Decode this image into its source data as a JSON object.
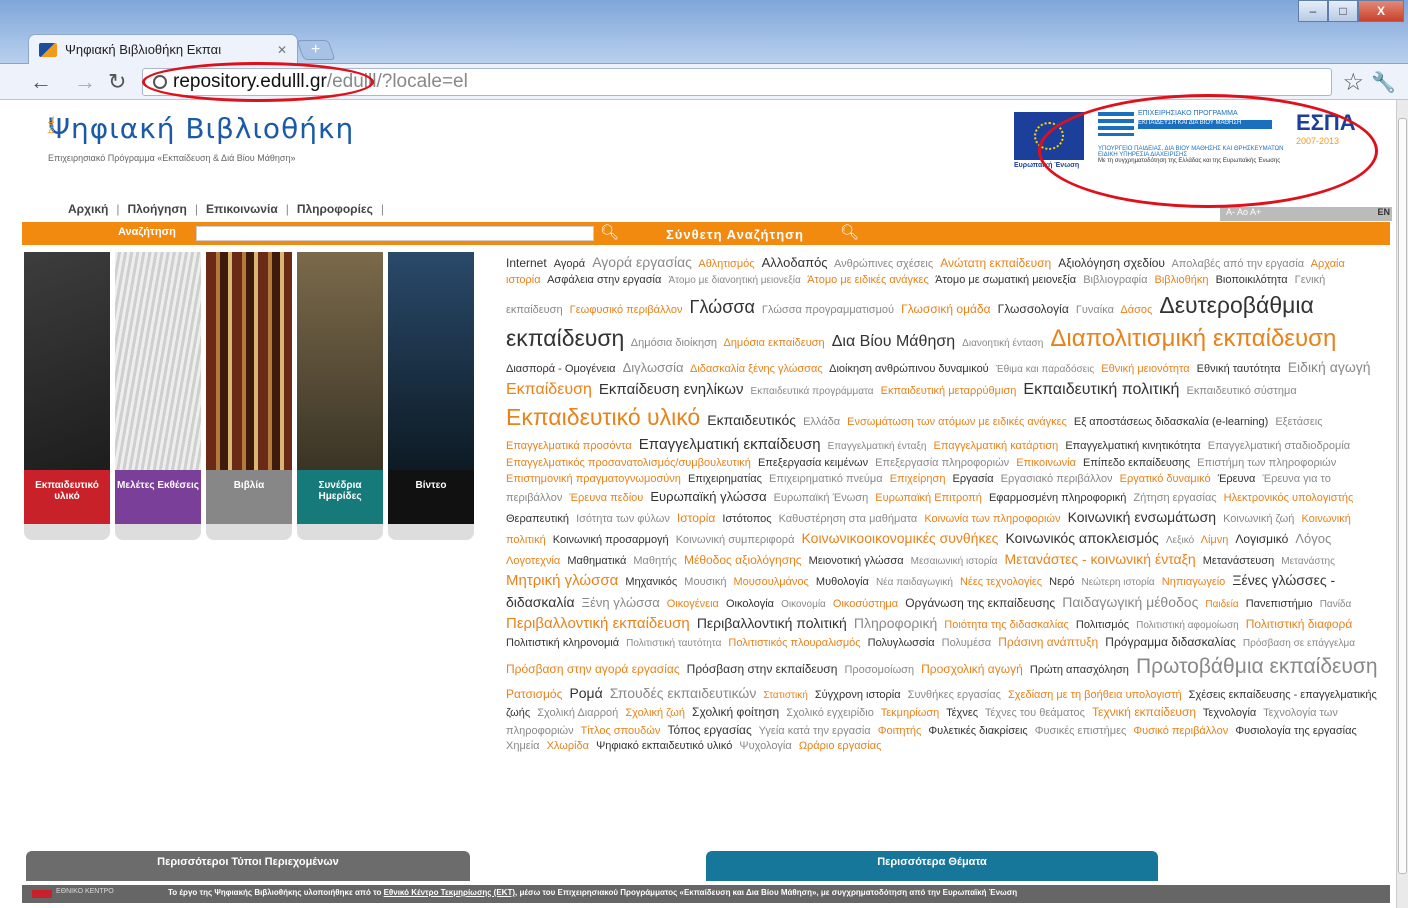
{
  "browser": {
    "tab_title": "Ψηφιακή Βιβλιοθήκη Εκπαι",
    "new_tab": "+",
    "url_host": "repository.edulll.gr",
    "url_path": "/edulll/?locale=el",
    "window_min": "‒",
    "window_max": "□",
    "window_close": "X"
  },
  "site": {
    "title": "Ψηφιακή Βιβλιοθήκη",
    "beta": "beta",
    "subtitle": "Επιχειρησιακό Πρόγραμμα «Εκπαίδευση & Διά Βίου Μάθηση»",
    "eu_caption": "Ευρωπαϊκή Ένωση",
    "program_line1": "ΕΠΙΧΕΙΡΗΣΙΑΚΟ ΠΡΟΓΡΑΜΜΑ",
    "program_line2": "ΕΚΠΑΙΔΕΥΣΗ ΚΑΙ ΔΙΑ ΒΙΟΥ ΜΑΘΗΣΗ",
    "program_line3": "ΥΠΟΥΡΓΕΙΟ ΠΑΙΔΕΙΑΣ, ΔΙΑ ΒΙΟΥ ΜΑΘΗΣΗΣ ΚΑΙ ΘΡΗΣΚΕΥΜΑΤΩΝ  ΕΙΔΙΚΗ ΥΠΗΡΕΣΙΑ ΔΙΑΧΕΙΡΙΣΗΣ",
    "program_line4": "Με τη συγχρηματοδότηση της Ελλάδας και της Ευρωπαϊκής Ένωσης",
    "espa": "ΕΣΠΑ",
    "espa_years": "2007-2013"
  },
  "nav": {
    "home": "Αρχική",
    "navigation": "Πλοήγηση",
    "contact": "Επικοινωνία",
    "info": "Πληροφορίες",
    "sep": "|",
    "font_sizes": "A- Ao A+",
    "lang": "EN"
  },
  "search": {
    "label": "Αναζήτηση",
    "advanced": "Σύνθετη Αναζήτηση"
  },
  "tiles": [
    {
      "label": "Εκπαιδευτικό υλικό"
    },
    {
      "label": "Μελέτες Εκθέσεις"
    },
    {
      "label": "Βιβλία"
    },
    {
      "label": "Συνέδρια Ημερίδες"
    },
    {
      "label": "Βίντεο"
    }
  ],
  "tag_cloud": [
    [
      "Internet",
      "d",
      12
    ],
    [
      "Αγορά",
      "d",
      11
    ],
    [
      "Αγορά εργασίας",
      "g",
      14
    ],
    [
      "Αθλητισμός",
      "o",
      11
    ],
    [
      "Αλλοδαπός",
      "d",
      13
    ],
    [
      "Ανθρώπινες σχέσεις",
      "g",
      11
    ],
    [
      "Ανώτατη εκπαίδευση",
      "o",
      12
    ],
    [
      "Αξιολόγηση σχεδίου",
      "d",
      12
    ],
    [
      "Απολαβές από την εργασία",
      "g",
      11
    ],
    [
      "Αρχαία ιστορία",
      "o",
      11
    ],
    [
      "Ασφάλεια στην εργασία",
      "d",
      11
    ],
    [
      "Άτομο με διανοητική μειονεξία",
      "g",
      10
    ],
    [
      "Άτομο με ειδικές ανάγκες",
      "o",
      11
    ],
    [
      "Άτομο με σωματική μειονεξία",
      "d",
      11
    ],
    [
      "Βιβλιογραφία",
      "g",
      11
    ],
    [
      "Βιβλιοθήκη",
      "o",
      11
    ],
    [
      "Βιοποικιλότητα",
      "d",
      11
    ],
    [
      "Γενική εκπαίδευση",
      "g",
      11
    ],
    [
      "Γεωφυσικό περιβάλλον",
      "o",
      11
    ],
    [
      "Γλώσσα",
      "d",
      18
    ],
    [
      "Γλώσσα προγραμματισμού",
      "g",
      11
    ],
    [
      "Γλωσσική ομάδα",
      "o",
      12
    ],
    [
      "Γλωσσολογία",
      "d",
      12
    ],
    [
      "Γυναίκα",
      "g",
      11
    ],
    [
      "Δάσος",
      "o",
      11
    ],
    [
      "Δευτεροβάθμια εκπαίδευση",
      "d",
      23
    ],
    [
      "Δημόσια διοίκηση",
      "g",
      11
    ],
    [
      "Δημόσια εκπαίδευση",
      "o",
      11
    ],
    [
      "Δια Βίου Μάθηση",
      "d",
      16
    ],
    [
      "Διανοητική ένταση",
      "g",
      10
    ],
    [
      "Διαπολιτισμική εκπαίδευση",
      "o",
      24
    ],
    [
      "Διασπορά - Ομογένεια",
      "d",
      11
    ],
    [
      "Διγλωσσία",
      "g",
      13
    ],
    [
      "Διδασκαλία ξένης γλώσσας",
      "o",
      11
    ],
    [
      "Διοίκηση ανθρώπινου δυναμικού",
      "d",
      11
    ],
    [
      "Έθιμα και παραδόσεις",
      "g",
      10
    ],
    [
      "Εθνική μειονότητα",
      "o",
      11
    ],
    [
      "Εθνική ταυτότητα",
      "d",
      11
    ],
    [
      "Ειδική αγωγή",
      "g",
      14
    ],
    [
      "Εκπαίδευση",
      "o",
      16
    ],
    [
      "Εκπαίδευση ενηλίκων",
      "d",
      15
    ],
    [
      "Εκπαιδευτικά προγράμματα",
      "g",
      10
    ],
    [
      "Εκπαιδευτική μεταρρύθμιση",
      "o",
      11
    ],
    [
      "Εκπαιδευτική πολιτική",
      "d",
      16
    ],
    [
      "Εκπαιδευτικό σύστημα",
      "g",
      11
    ],
    [
      "Εκπαιδευτικό υλικό",
      "o",
      23
    ],
    [
      "Εκπαιδευτικός",
      "d",
      14
    ],
    [
      "Ελλάδα",
      "g",
      11
    ],
    [
      "Ενσωμάτωση των ατόμων με ειδικές ανάγκες",
      "o",
      11
    ],
    [
      "Εξ αποστάσεως διδασκαλία (e-learning)",
      "d",
      11
    ],
    [
      "Εξετάσεις",
      "g",
      11
    ],
    [
      "Επαγγελματικά προσόντα",
      "o",
      11
    ],
    [
      "Επαγγελματική εκπαίδευση",
      "d",
      15
    ],
    [
      "Επαγγελματική ένταξη",
      "g",
      10
    ],
    [
      "Επαγγελματική κατάρτιση",
      "o",
      11
    ],
    [
      "Επαγγελματική κινητικότητα",
      "d",
      11
    ],
    [
      "Επαγγελματική σταδιοδρομία",
      "g",
      11
    ],
    [
      "Επαγγελματικός προσανατολισμός/συμβουλευτική",
      "o",
      11
    ],
    [
      "Επεξεργασία κειμένων",
      "d",
      11
    ],
    [
      "Επεξεργασία πληροφοριών",
      "g",
      11
    ],
    [
      "Επικοινωνία",
      "o",
      11
    ],
    [
      "Επίπεδο εκπαίδευσης",
      "d",
      11
    ],
    [
      "Επιστήμη των πληροφοριών",
      "g",
      11
    ],
    [
      "Επιστημονική πραγματογνωμοσύνη",
      "o",
      11
    ],
    [
      "Επιχειρηματίας",
      "d",
      11
    ],
    [
      "Επιχειρηματικό πνεύμα",
      "g",
      11
    ],
    [
      "Επιχείρηση",
      "o",
      11
    ],
    [
      "Εργασία",
      "d",
      11
    ],
    [
      "Εργασιακό περιβάλλον",
      "g",
      11
    ],
    [
      "Εργατικό δυναμικό",
      "o",
      11
    ],
    [
      "Έρευνα",
      "d",
      11
    ],
    [
      "Έρευνα για το περιβάλλον",
      "g",
      11
    ],
    [
      "Έρευνα πεδίου",
      "o",
      11
    ],
    [
      "Ευρωπαϊκή γλώσσα",
      "d",
      13
    ],
    [
      "Ευρωπαϊκή Ένωση",
      "g",
      11
    ],
    [
      "Ευρωπαϊκή Επιτροπή",
      "o",
      11
    ],
    [
      "Εφαρμοσμένη πληροφορική",
      "d",
      11
    ],
    [
      "Ζήτηση εργασίας",
      "g",
      11
    ],
    [
      "Ηλεκτρονικός υπολογιστής",
      "o",
      11
    ],
    [
      "Θεραπευτική",
      "d",
      11
    ],
    [
      "Ισότητα των φύλων",
      "g",
      11
    ],
    [
      "Ιστορία",
      "o",
      12
    ],
    [
      "Ιστότοπος",
      "d",
      11
    ],
    [
      "Καθυστέρηση στα μαθήματα",
      "g",
      11
    ],
    [
      "Κοινωνία των πληροφοριών",
      "o",
      11
    ],
    [
      "Κοινωνική ενσωμάτωση",
      "d",
      14
    ],
    [
      "Κοινωνική ζωή",
      "g",
      11
    ],
    [
      "Κοινωνική πολιτική",
      "o",
      11
    ],
    [
      "Κοινωνική προσαρμογή",
      "d",
      11
    ],
    [
      "Κοινωνική συμπεριφορά",
      "g",
      11
    ],
    [
      "Κοινωνικοοικονομικές συνθήκες",
      "o",
      14
    ],
    [
      "Κοινωνικός αποκλεισμός",
      "d",
      14
    ],
    [
      "Λεξικό",
      "g",
      10
    ],
    [
      "Λίμνη",
      "o",
      11
    ],
    [
      "Λογισμικό",
      "d",
      12
    ],
    [
      "Λόγος",
      "g",
      13
    ],
    [
      "Λογοτεχνία",
      "o",
      11
    ],
    [
      "Μαθηματικά",
      "d",
      11
    ],
    [
      "Μαθητής",
      "g",
      11
    ],
    [
      "Μέθοδος αξιολόγησης",
      "o",
      12
    ],
    [
      "Μειονοτική γλώσσα",
      "d",
      11
    ],
    [
      "Μεσαιωνική ιστορία",
      "g",
      10
    ],
    [
      "Μετανάστες - κοινωνική ένταξη",
      "o",
      14
    ],
    [
      "Μετανάστευση",
      "d",
      11
    ],
    [
      "Μετανάστης",
      "g",
      10
    ],
    [
      "Μητρική γλώσσα",
      "o",
      15
    ],
    [
      "Μηχανικός",
      "d",
      11
    ],
    [
      "Μουσική",
      "g",
      11
    ],
    [
      "Μουσουλμάνος",
      "o",
      11
    ],
    [
      "Μυθολογία",
      "d",
      11
    ],
    [
      "Νέα παιδαγωγική",
      "g",
      10
    ],
    [
      "Νέες τεχνολογίες",
      "o",
      11
    ],
    [
      "Νερό",
      "d",
      11
    ],
    [
      "Νεώτερη ιστορία",
      "g",
      10
    ],
    [
      "Νηπιαγωγείο",
      "o",
      11
    ],
    [
      "Ξένες γλώσσες - διδασκαλία",
      "d",
      14
    ],
    [
      "Ξένη γλώσσα",
      "g",
      13
    ],
    [
      "Οικογένεια",
      "o",
      11
    ],
    [
      "Οικολογία",
      "d",
      11
    ],
    [
      "Οικονομία",
      "g",
      10
    ],
    [
      "Οικοσύστημα",
      "o",
      11
    ],
    [
      "Οργάνωση της εκπαίδευσης",
      "d",
      12
    ],
    [
      "Παιδαγωγική μέθοδος",
      "g",
      14
    ],
    [
      "Παιδεία",
      "o",
      10
    ],
    [
      "Πανεπιστήμιο",
      "d",
      11
    ],
    [
      "Πανίδα",
      "g",
      10
    ],
    [
      "Περιβαλλοντική εκπαίδευση",
      "o",
      15
    ],
    [
      "Περιβαλλοντική πολιτική",
      "d",
      14
    ],
    [
      "Πληροφορική",
      "g",
      14
    ],
    [
      "Ποιότητα της διδασκαλίας",
      "o",
      11
    ],
    [
      "Πολιτισμός",
      "d",
      11
    ],
    [
      "Πολιτιστική αφομοίωση",
      "g",
      10
    ],
    [
      "Πολιτιστική διαφορά",
      "o",
      12
    ],
    [
      "Πολιτιστική κληρονομιά",
      "d",
      11
    ],
    [
      "Πολιτιστική ταυτότητα",
      "g",
      10
    ],
    [
      "Πολιτιστικός πλουραλισμός",
      "o",
      11
    ],
    [
      "Πολυγλωσσία",
      "d",
      11
    ],
    [
      "Πολυμέσα",
      "g",
      11
    ],
    [
      "Πράσινη ανάπτυξη",
      "o",
      12
    ],
    [
      "Πρόγραμμα διδασκαλίας",
      "d",
      12
    ],
    [
      "Πρόσβαση σε επάγγελμα",
      "g",
      10
    ],
    [
      "Πρόσβαση στην αγορά εργασίας",
      "o",
      12
    ],
    [
      "Πρόσβαση στην εκπαίδευση",
      "d",
      12
    ],
    [
      "Προσομοίωση",
      "g",
      11
    ],
    [
      "Προσχολική αγωγή",
      "o",
      12
    ],
    [
      "Πρώτη απασχόληση",
      "d",
      11
    ],
    [
      "Πρωτοβάθμια εκπαίδευση",
      "g",
      21
    ],
    [
      "Ρατσισμός",
      "o",
      12
    ],
    [
      "Ρομά",
      "d",
      14
    ],
    [
      "Σπουδές εκπαιδευτικών",
      "g",
      14
    ],
    [
      "Στατιστική",
      "o",
      10
    ],
    [
      "Σύγχρονη ιστορία",
      "d",
      11
    ],
    [
      "Συνθήκες εργασίας",
      "g",
      11
    ],
    [
      "Σχεδίαση με τη βοήθεια υπολογιστή",
      "o",
      11
    ],
    [
      "Σχέσεις εκπαίδευσης - επαγγελματικής ζωής",
      "d",
      11
    ],
    [
      "Σχολική Διαρροή",
      "g",
      11
    ],
    [
      "Σχολική ζωή",
      "o",
      11
    ],
    [
      "Σχολική φοίτηση",
      "d",
      12
    ],
    [
      "Σχολικό εγχειρίδιο",
      "g",
      11
    ],
    [
      "Τεκμηρίωση",
      "o",
      11
    ],
    [
      "Τέχνες",
      "d",
      11
    ],
    [
      "Τέχνες του θεάματος",
      "g",
      11
    ],
    [
      "Τεχνική εκπαίδευση",
      "o",
      12
    ],
    [
      "Τεχνολογία",
      "d",
      11
    ],
    [
      "Τεχνολογία των πληροφοριών",
      "g",
      11
    ],
    [
      "Τίτλος σπουδών",
      "o",
      11
    ],
    [
      "Τόπος εργασίας",
      "d",
      12
    ],
    [
      "Υγεία κατά την εργασία",
      "g",
      11
    ],
    [
      "Φοιτητής",
      "o",
      11
    ],
    [
      "Φυλετικές διακρίσεις",
      "d",
      11
    ],
    [
      "Φυσικές επιστήμες",
      "g",
      11
    ],
    [
      "Φυσικό περιβάλλον",
      "o",
      11
    ],
    [
      "Φυσιολογία της εργασίας",
      "d",
      11
    ],
    [
      "Χημεία",
      "g",
      11
    ],
    [
      "Χλωρίδα",
      "o",
      11
    ],
    [
      "Ψηφιακό εκπαιδευτικό υλικό",
      "d",
      11
    ],
    [
      "Ψυχολογία",
      "g",
      11
    ],
    [
      "Ωράριο εργασίας",
      "o",
      11
    ]
  ],
  "bottom": {
    "more_types": "Περισσότεροι Τύποι Περιεχομένων",
    "more_topics": "Περισσότερα Θέματα"
  },
  "footer": {
    "ekt_label": "ΕΘΝΙΚΟ ΚΕΝΤΡΟ",
    "text_before": "Το έργο της Ψηφιακής Βιβλιοθήκης υλοποιήθηκε από το",
    "ekt_link": "Εθνικό Κέντρο Τεκμηρίωσης (ΕΚΤ)",
    "text_after": ", μέσω του Επιχειρησιακού Προγράμματος «Εκπαίδευση και Δια Βίου Μάθηση», με συγχρηματοδότηση από την Ευρωπαϊκή Ένωση"
  }
}
